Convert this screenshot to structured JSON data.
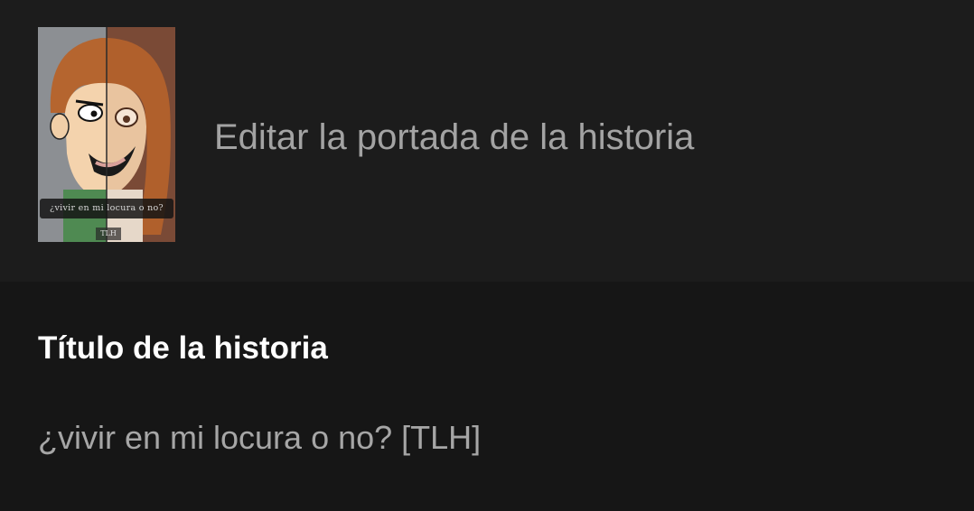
{
  "cover": {
    "caption": "¿vivir en mi locura o no?",
    "tag": "TLH",
    "action_label": "Editar la portada de la historia"
  },
  "title_field": {
    "label": "Título de la historia",
    "value": "¿vivir en mi locura o no? [TLH]"
  },
  "colors": {
    "top_section_bg": "#1c1c1c",
    "bottom_section_bg": "#161616",
    "label_text": "#ffffff",
    "secondary_text": "#a6a6a6"
  }
}
